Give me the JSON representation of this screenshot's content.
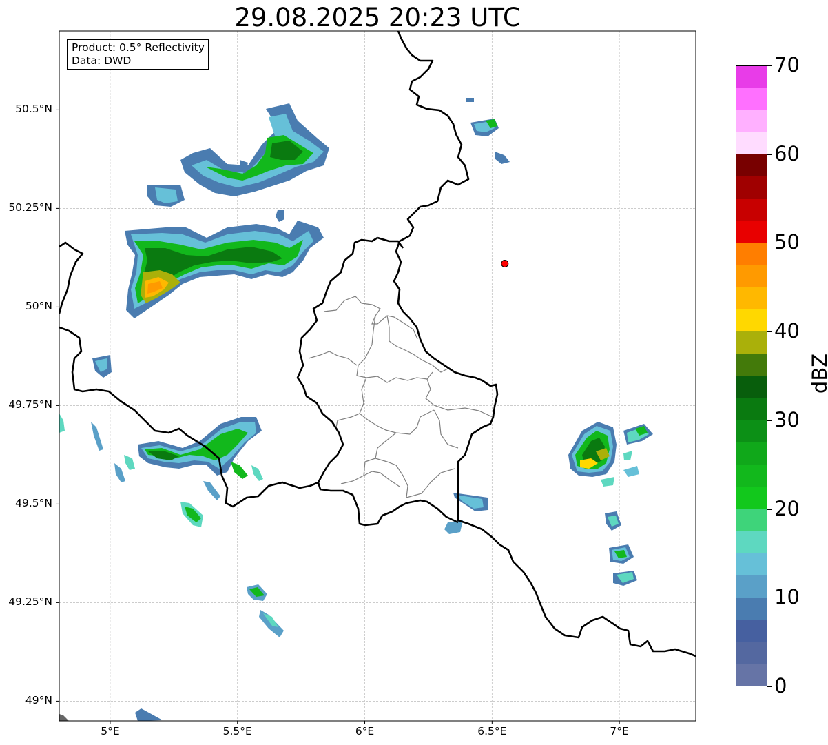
{
  "title": "29.08.2025 20:23 UTC",
  "info": {
    "product": "Product: 0.5° Reflectivity",
    "data": "Data: DWD"
  },
  "map": {
    "extent": {
      "lon_min": 4.8,
      "lon_max": 7.3,
      "lat_min": 48.95,
      "lat_max": 50.7
    },
    "lat_ticks": [
      {
        "value": 50.5,
        "label": "50.5°N"
      },
      {
        "value": 50.25,
        "label": "50.25°N"
      },
      {
        "value": 50.0,
        "label": "50°N"
      },
      {
        "value": 49.75,
        "label": "49.75°N"
      },
      {
        "value": 49.5,
        "label": "49.5°N"
      },
      {
        "value": 49.25,
        "label": "49.25°N"
      },
      {
        "value": 49.0,
        "label": "49°N"
      }
    ],
    "lon_ticks": [
      {
        "value": 5.0,
        "label": "5°E"
      },
      {
        "value": 5.5,
        "label": "5.5°E"
      },
      {
        "value": 6.0,
        "label": "6°E"
      },
      {
        "value": 6.5,
        "label": "6.5°E"
      },
      {
        "value": 7.0,
        "label": "7°E"
      }
    ],
    "grid": true,
    "radar_site": {
      "lon": 6.55,
      "lat": 50.11,
      "color": "#ff0000"
    }
  },
  "colorbar": {
    "label": "dBZ",
    "min": 0,
    "max": 70,
    "ticks": [
      "0",
      "10",
      "20",
      "30",
      "40",
      "50",
      "60",
      "70"
    ],
    "colors": [
      "#6674a6",
      "#5468a0",
      "#4660a0",
      "#4a7cb0",
      "#5aa0c8",
      "#66c0d8",
      "#5ed8c0",
      "#3ed47a",
      "#12c81c",
      "#12b81c",
      "#10a81a",
      "#0c9016",
      "#0a7a10",
      "#085e0c",
      "#437a0a",
      "#aab00a",
      "#ffd800",
      "#ffb800",
      "#ff9a00",
      "#ff7e00",
      "#e80000",
      "#c80000",
      "#a00000",
      "#780000",
      "#ffdcff",
      "#ffb0ff",
      "#ff70ff",
      "#e83ce8"
    ]
  }
}
